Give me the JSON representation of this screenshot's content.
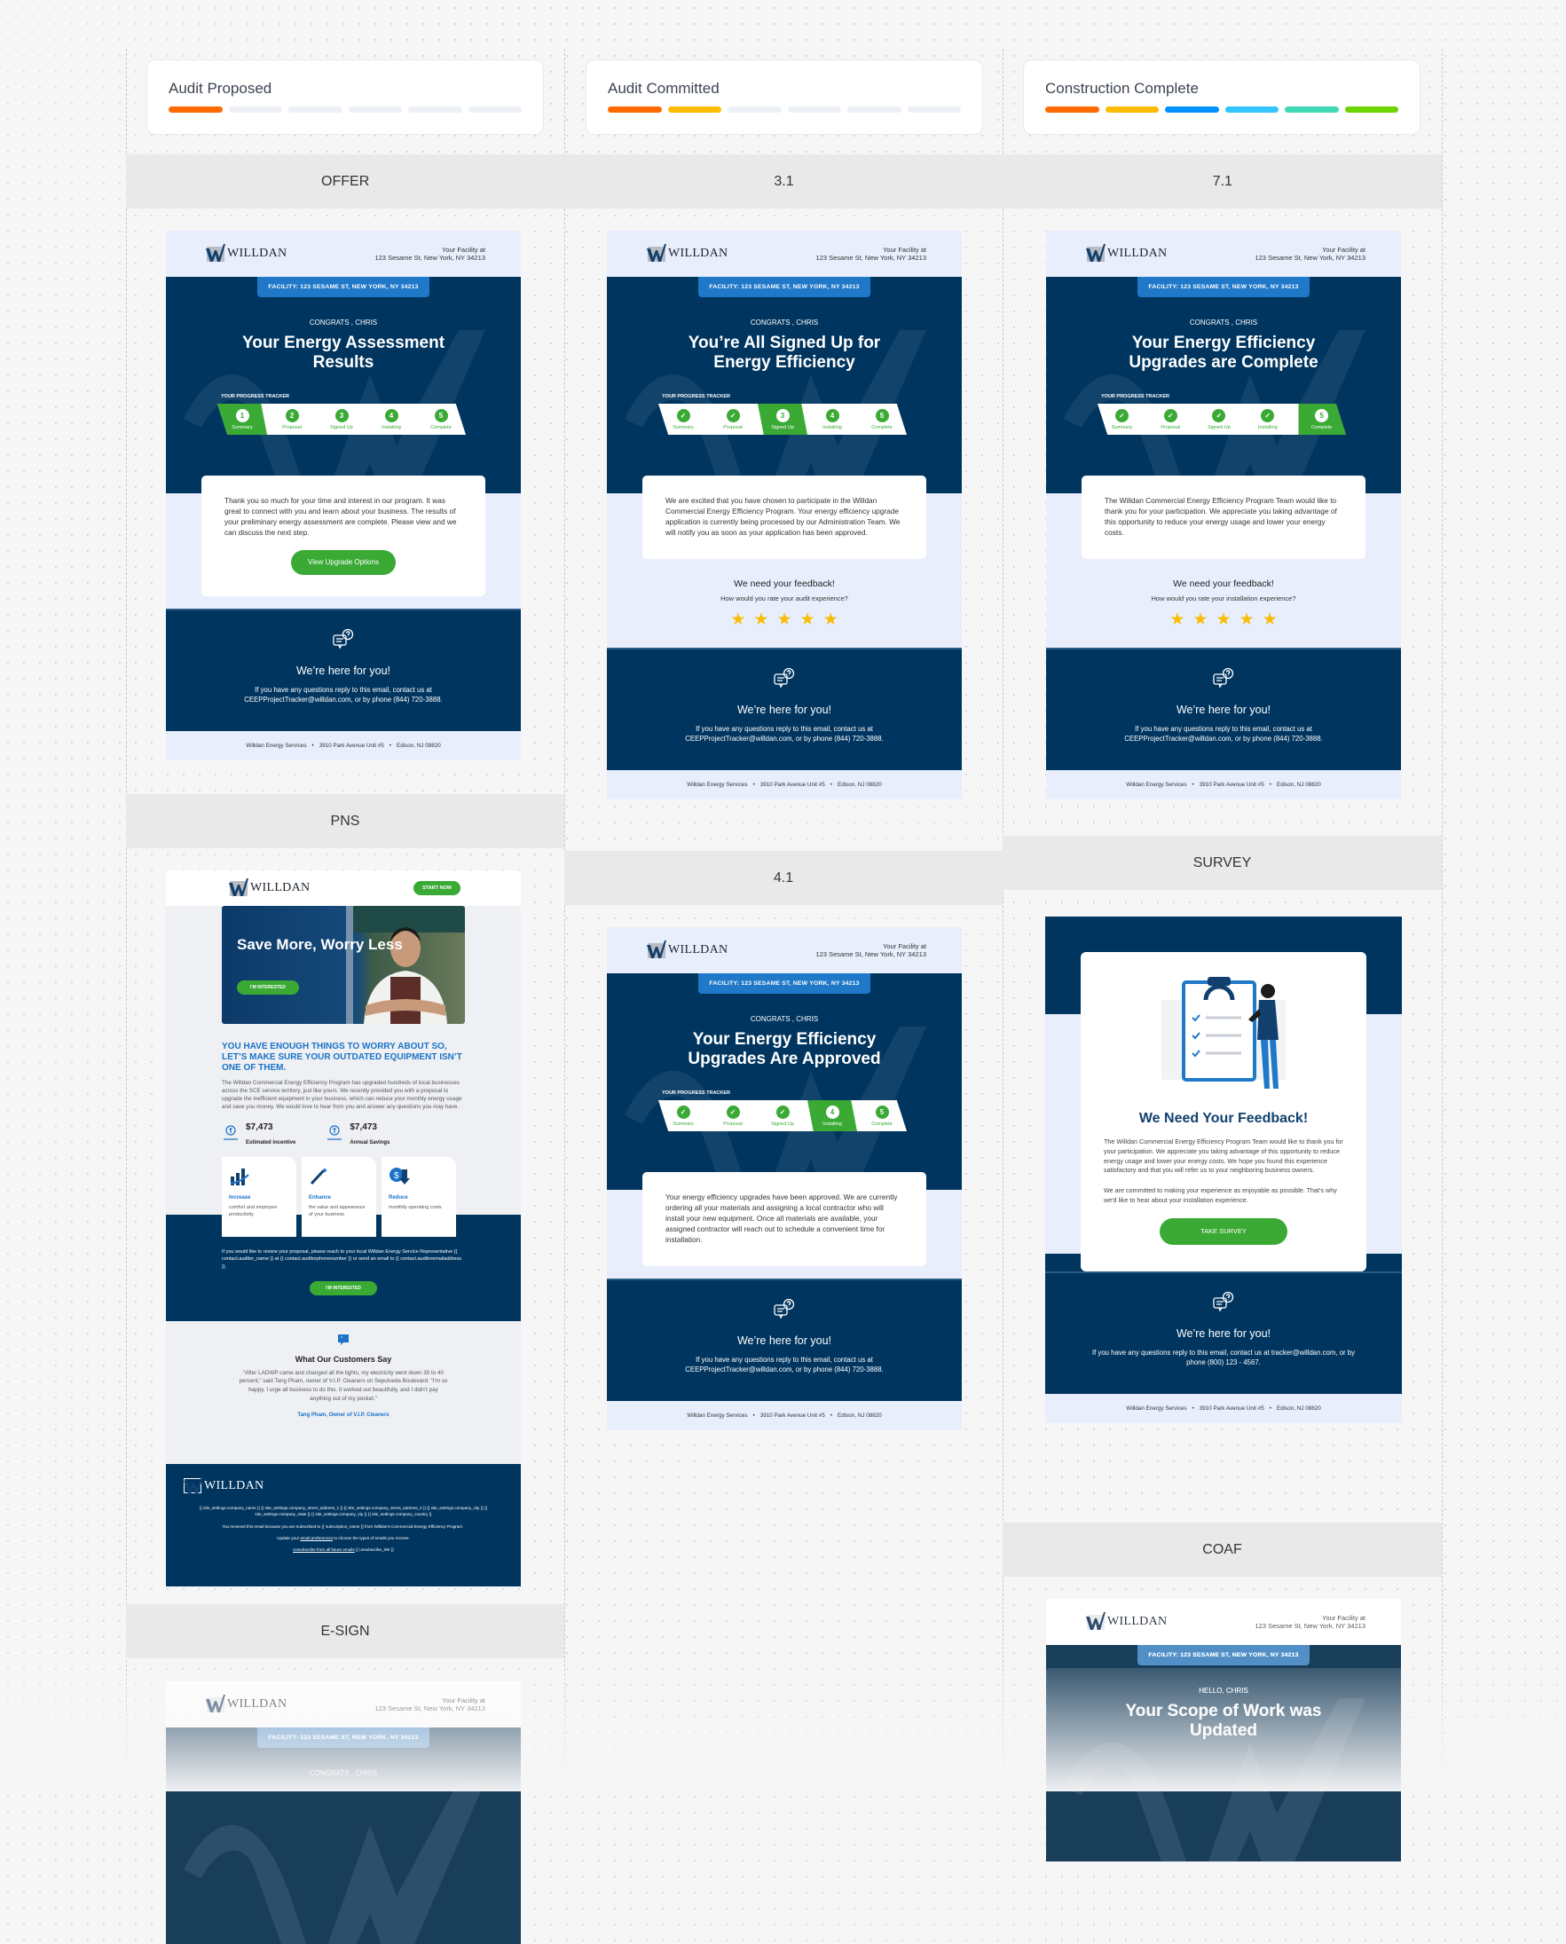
{
  "stages": [
    {
      "title": "Audit Proposed",
      "segments": [
        "#ff6a00",
        "#edf1f6",
        "#edf1f6",
        "#edf1f6",
        "#edf1f6",
        "#edf1f6"
      ]
    },
    {
      "title": "Audit Committed",
      "segments": [
        "#ff6a00",
        "#fbbc05",
        "#edf1f6",
        "#edf1f6",
        "#edf1f6",
        "#edf1f6"
      ]
    },
    {
      "title": "Construction Complete",
      "segments": [
        "#ff6a00",
        "#fbbc05",
        "#0091ff",
        "#33c5ff",
        "#40d8b5",
        "#6dd400"
      ]
    }
  ],
  "bands": {
    "offer": "OFFER",
    "v31": "3.1",
    "v71": "7.1",
    "pns": "PNS",
    "v41": "4.1",
    "survey": "SURVEY",
    "esign": "E-SIGN",
    "coaf": "COAF"
  },
  "colors": {
    "navy": "#00355f",
    "green": "#3aaa35",
    "light": "#e8eefc",
    "pill": "#1f78c8",
    "star": "#fbbc05"
  },
  "common": {
    "logo_text": "WILLDAN",
    "facility_label": "Your Facility at",
    "facility_address": "123 Sesame St, New York, NY 34213",
    "pill": "FACILITY: 123 SESAME ST, NEW YORK, NY 34213",
    "tracker_label": "YOUR PROGRESS TRACKER",
    "steps": [
      "Summary",
      "Proposal",
      "Signed Up",
      "Installing",
      "Complete"
    ],
    "help_title": "We’re here for you!",
    "help_text": "If you have any questions reply to this email, contact us at CEEPProjectTracker@willdan.com, or by phone (844) 720-3888.",
    "address": [
      "Willdan Energy Services",
      "3910 Park Avenue Unit #5",
      "Edison, NJ 08820"
    ],
    "address_sep": "•"
  },
  "emails": {
    "offer": {
      "greeting": "CONGRATS , CHRIS",
      "title": "Your Energy Assessment Results",
      "active_step": 1,
      "body": "Thank you so much for your time and interest in our program. It was great to connect with you and learn about your business. The results of your preliminary energy assessment are complete.  Please view and we can discuss the next step.",
      "button": "View Upgrade Options"
    },
    "v31": {
      "greeting": "CONGRATS , CHRIS",
      "title": "You’re All Signed Up for Energy Efficiency",
      "active_step": 3,
      "body": "We are excited that you have chosen to participate in the Willdan Commercial Energy Efficiency Program. Your energy efficiency upgrade application is currently being processed by our Administration Team. We will notify you as soon as your application has been approved.",
      "feedback_title": "We need your feedback!",
      "feedback_question": "How would you rate your audit experience?",
      "stars": 5
    },
    "v71": {
      "greeting": "CONGRATS , CHRIS",
      "title": "Your Energy Efficiency Upgrades are Complete",
      "active_step": 5,
      "body": "The Willdan Commercial Energy Efficiency Program Team would like to thank you for your participation. We appreciate you taking advantage of this opportunity to reduce your energy usage and lower your energy costs.",
      "feedback_title": "We need your feedback!",
      "feedback_question": "How would you rate your installation experience?",
      "stars": 5
    },
    "v41": {
      "greeting": "CONGRATS , CHRIS",
      "title": "Your Energy Efficiency Upgrades Are Approved",
      "active_step": 4,
      "body": "Your energy efficiency upgrades have been approved. We are currently ordering all your materials and assigning a local contractor who will install your new equipment. Once all materials are available, your assigned contractor will reach out to schedule a convenient time for installation."
    },
    "coaf": {
      "greeting": "HELLO, CHRIS",
      "title": "Your Scope of Work was Updated"
    },
    "esign": {
      "greeting": "CONGRATS , CHRIS"
    }
  },
  "pns": {
    "start_now": "START NOW",
    "hero_title": "Save More, Worry Less",
    "interested": "I'M INTERESTED",
    "headline": "YOU HAVE ENOUGH THINGS TO WORRY ABOUT SO, LET’S MAKE SURE YOUR OUTDATED EQUIPMENT ISN’T ONE OF THEM.",
    "paragraph": "The Willdan Commercial Energy Efficiency Program has upgraded hundreds of local businesses across the SCE service territory, just like yours.  We recently provided you with a proposal to upgrade the inefficient equipment in your business, which can reduce your monthly energy usage and save you money.  We would love to hear from you and answer any questions you may have.",
    "stats": [
      {
        "value": "$7,473",
        "label": "Estimated incentive"
      },
      {
        "value": "$7,473",
        "label": "Annual Savings"
      }
    ],
    "cards": [
      {
        "title": "Increase",
        "text": "comfort and employee productivity"
      },
      {
        "title": "Enhance",
        "text": "the value and appearance of your business"
      },
      {
        "title": "Reduce",
        "text": "monthtly operating costs"
      }
    ],
    "review_text": "If you would like to review your proposal, please reach to your local Willdan Energy Service Representative {{ contact.auditor_name }} at {{ contact.auditorphonenumber }} or send an email to {{ contact.auditoremailaddress }}.",
    "interested_2": "I'M INTERESTED",
    "testimonial_title": "What Our Customers Say",
    "testimonial": "“After LADWP came and changed all the lights, my electricity went down 30 to 40 percent,” said Tang Pham, owner of V.I.P. Cleaners on Sepulveda Boulevard. “I’m so happy. I urge all business to do this. It worked out beautifully, and I didn’t pay anything out of my pocket.”",
    "testimonial_author": "Tang Pham, Owner of V.I.P. Cleaners",
    "footer_address": "{{ site_settings.company_name }}  {{ site_settings.company_street_address_1 }}  {{ site_settings.company_street_address_2 }}  {{ site_settings.company_city }}  {{ site_settings.company_state }}  {{ site_settings.company_zip }}  {{ site_settings.company_country }}",
    "footer_subscribed": "You received this email because you are subscribed to {{ subscription_name }} from Willdan's Commercial Energy Efficiency Program .",
    "footer_update_pre": "Update your",
    "footer_update_link": "email preferences",
    "footer_update_post": "to choose the types of emails you receive.",
    "footer_unsub_link": "Unsubscribe from all future emails",
    "footer_unsub_tag": "{{ unsubscribe_link }}"
  },
  "survey": {
    "title": "We Need Your Feedback!",
    "p1": "The Willdan Commercial Energy Efficiency Program Team would like to thank you for your participation. We appreciate you taking advantage of this opportunity to reduce energy usage and lower your energy costs. We hope you found this experience satisfactory and that you will refer us to your neighboring business owners.",
    "p2": "We are committed to making your experience as enjoyable as possible. That's why we'd like to hear about your installation experience.",
    "button": "TAKE SURVEY",
    "help_text": "If you have any questions reply to this email, contact us at tracker@willdan.com, or by phone (800) 123 - 4567."
  }
}
